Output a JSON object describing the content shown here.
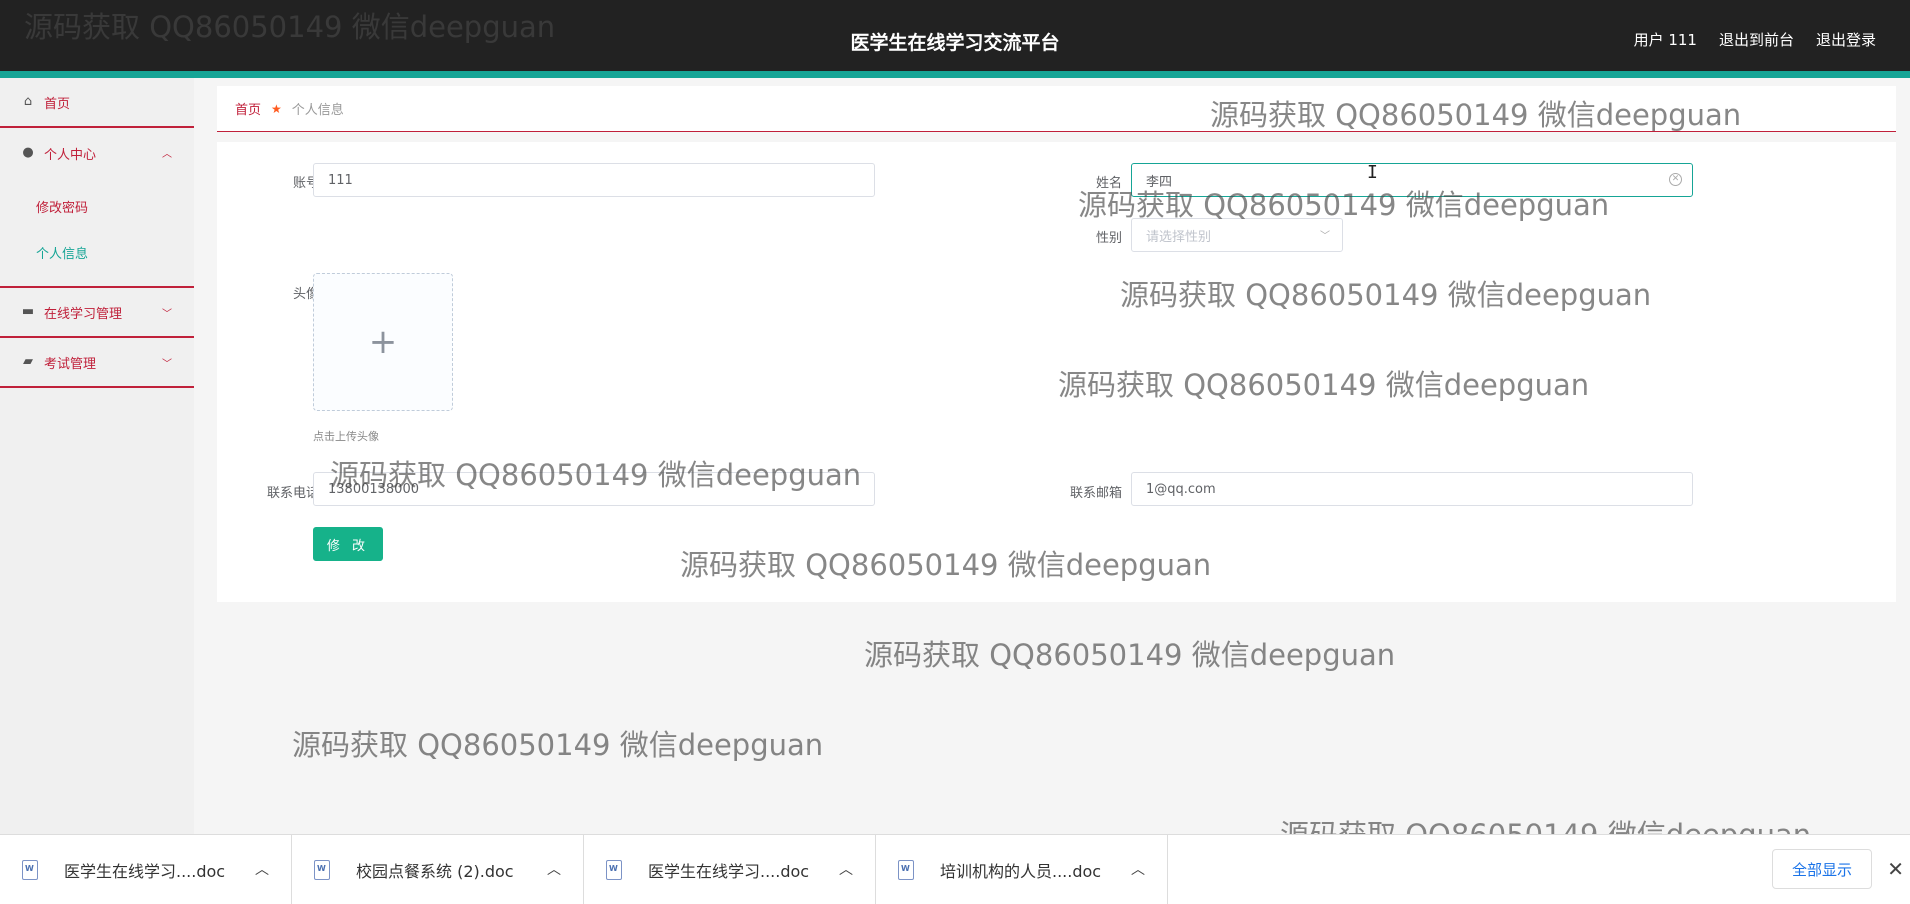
{
  "header": {
    "title": "医学生在线学习交流平台",
    "user": "用户 111",
    "to_front": "退出到前台",
    "logout": "退出登录"
  },
  "sidebar": {
    "home": "首页",
    "personal_center": "个人中心",
    "change_password": "修改密码",
    "personal_info": "个人信息",
    "online_learning": "在线学习管理",
    "exam": "考试管理"
  },
  "breadcrumb": {
    "home": "首页",
    "current": "个人信息"
  },
  "form": {
    "account_label": "账号",
    "account_value": "111",
    "name_label": "姓名",
    "name_value": "李四",
    "gender_label": "性别",
    "gender_placeholder": "请选择性别",
    "avatar_label": "头像",
    "upload_tip": "点击上传头像",
    "phone_label": "联系电话",
    "phone_value": "13800138000",
    "email_label": "联系邮箱",
    "email_value": "1@qq.com",
    "submit": "修 改"
  },
  "watermark": "源码获取 QQ86050149 微信deepguan",
  "downloads": {
    "items": [
      "医学生在线学习....doc",
      "校园点餐系统 (2).doc",
      "医学生在线学习....doc",
      "培训机构的人员....doc"
    ],
    "show_all": "全部显示"
  }
}
